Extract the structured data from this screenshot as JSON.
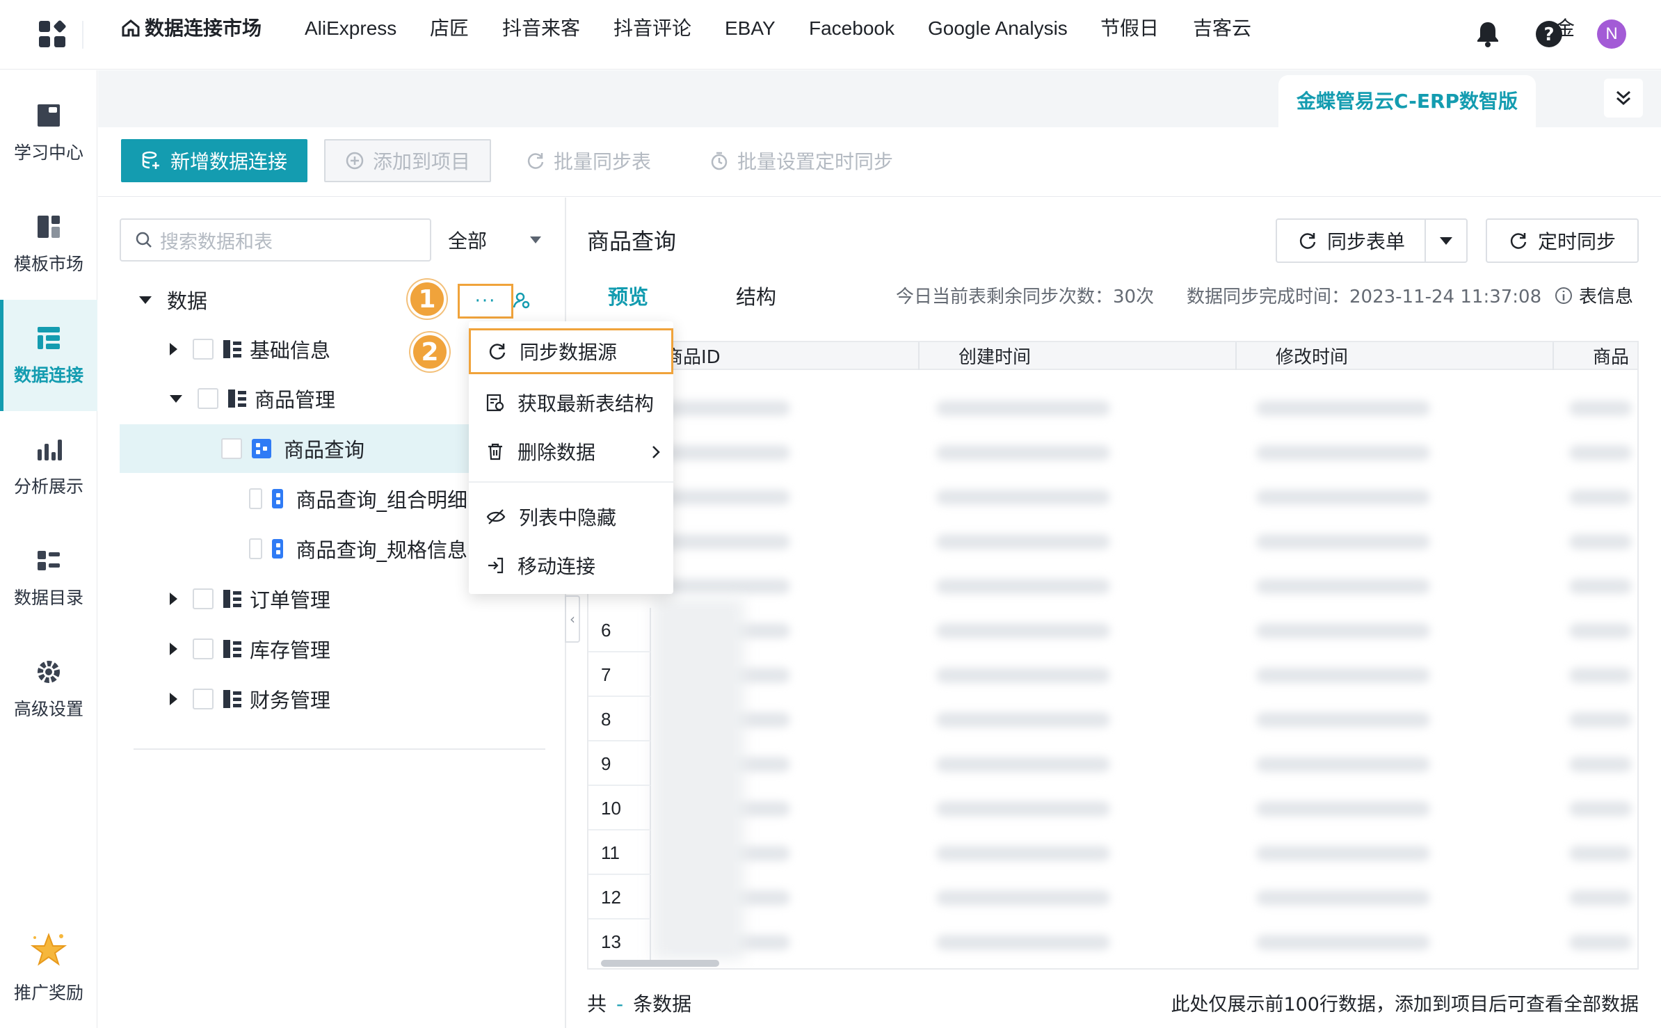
{
  "header": {
    "avatar_letter": "N",
    "icons": [
      "apps-logo-icon",
      "bell-icon",
      "help-icon"
    ]
  },
  "nav": {
    "items": [
      {
        "label": "学习中心",
        "icon": "book-icon",
        "active": false
      },
      {
        "label": "模板市场",
        "icon": "template-icon",
        "active": false
      },
      {
        "label": "数据连接",
        "icon": "data-connect-icon",
        "active": true
      },
      {
        "label": "分析展示",
        "icon": "chart-icon",
        "active": false
      },
      {
        "label": "数据目录",
        "icon": "catalog-icon",
        "active": false
      },
      {
        "label": "高级设置",
        "icon": "gear-icon",
        "active": false
      },
      {
        "label": "推广奖励",
        "icon": "star-icon",
        "active": false
      }
    ]
  },
  "tabs": {
    "home": "数据连接市场",
    "items": [
      "AliExpress",
      "店匠",
      "抖音来客",
      "抖音评论",
      "EBAY",
      "Facebook",
      "Google Analysis",
      "节假日",
      "吉客云",
      "金蝶管易云C-ERP数智版",
      "金"
    ],
    "active": "金蝶管易云C-ERP数智版"
  },
  "toolbar": {
    "new_connection": "新增数据连接",
    "add_to_project": "添加到项目",
    "batch_sync": "批量同步表",
    "batch_schedule": "批量设置定时同步"
  },
  "left": {
    "search_placeholder": "搜索数据和表",
    "filter": "全部",
    "tree": {
      "root": "数据",
      "folders": [
        "基础信息",
        "商品管理",
        "订单管理",
        "库存管理",
        "财务管理"
      ],
      "tables": [
        "商品查询",
        "商品查询_组合明细",
        "商品查询_规格信息"
      ]
    },
    "more": "···",
    "badge1": "1",
    "badge2": "2"
  },
  "menu": {
    "items": [
      "同步数据源",
      "获取最新表结构",
      "删除数据",
      "列表中隐藏",
      "移动连接"
    ]
  },
  "right": {
    "title": "商品查询",
    "sync_table": "同步表单",
    "schedule_sync": "定时同步",
    "tabs": [
      "预览",
      "结构"
    ],
    "remaining": "今日当前表剩余同步次数：30次",
    "completed": "数据同步完成时间：2023-11-24 11:37:08",
    "table_info": "表信息",
    "columns": [
      "商品ID",
      "创建时间",
      "修改时间",
      "商品"
    ],
    "row_numbers": [
      "6",
      "7",
      "8",
      "9",
      "10",
      "11",
      "12",
      "13"
    ],
    "footer_total_prefix": "共",
    "footer_total_value": "-",
    "footer_total_suffix": "条数据",
    "footer_note": "此处仅展示前100行数据，添加到项目后可查看全部数据"
  },
  "colors": {
    "accent": "#149cb0",
    "highlight": "#f0a33b",
    "table_icon": "#2f7bf5"
  }
}
